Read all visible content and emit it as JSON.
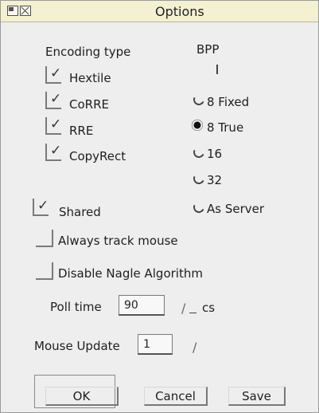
{
  "window": {
    "title": "Options",
    "icons": [
      "toggle-size-icon",
      "close-icon"
    ]
  },
  "encoding": {
    "heading": "Encoding type",
    "items": [
      {
        "label": "Hextile",
        "checked": true
      },
      {
        "label": "CoRRE",
        "checked": true
      },
      {
        "label": "RRE",
        "checked": true
      },
      {
        "label": "CopyRect",
        "checked": true
      }
    ]
  },
  "bpp": {
    "heading": "BPP",
    "options": [
      {
        "label": "8 Fixed",
        "selected": false
      },
      {
        "label": "8 True",
        "selected": true
      },
      {
        "label": "16",
        "selected": false
      },
      {
        "label": "32",
        "selected": false
      },
      {
        "label": "As Server",
        "selected": false
      }
    ]
  },
  "options": {
    "shared": {
      "label": "Shared",
      "checked": true
    },
    "track_mouse": {
      "label": "Always track mouse",
      "checked": false
    },
    "disable_nagle": {
      "label": "Disable Nagle Algorithm",
      "checked": false
    }
  },
  "poll": {
    "label": "Poll time",
    "value": "90",
    "unit_slash": "/",
    "unit": "cs"
  },
  "mouse_update": {
    "label": "Mouse Update",
    "value": "1",
    "unit_slash": "/"
  },
  "buttons": {
    "ok": "OK",
    "cancel": "Cancel",
    "save": "Save"
  }
}
